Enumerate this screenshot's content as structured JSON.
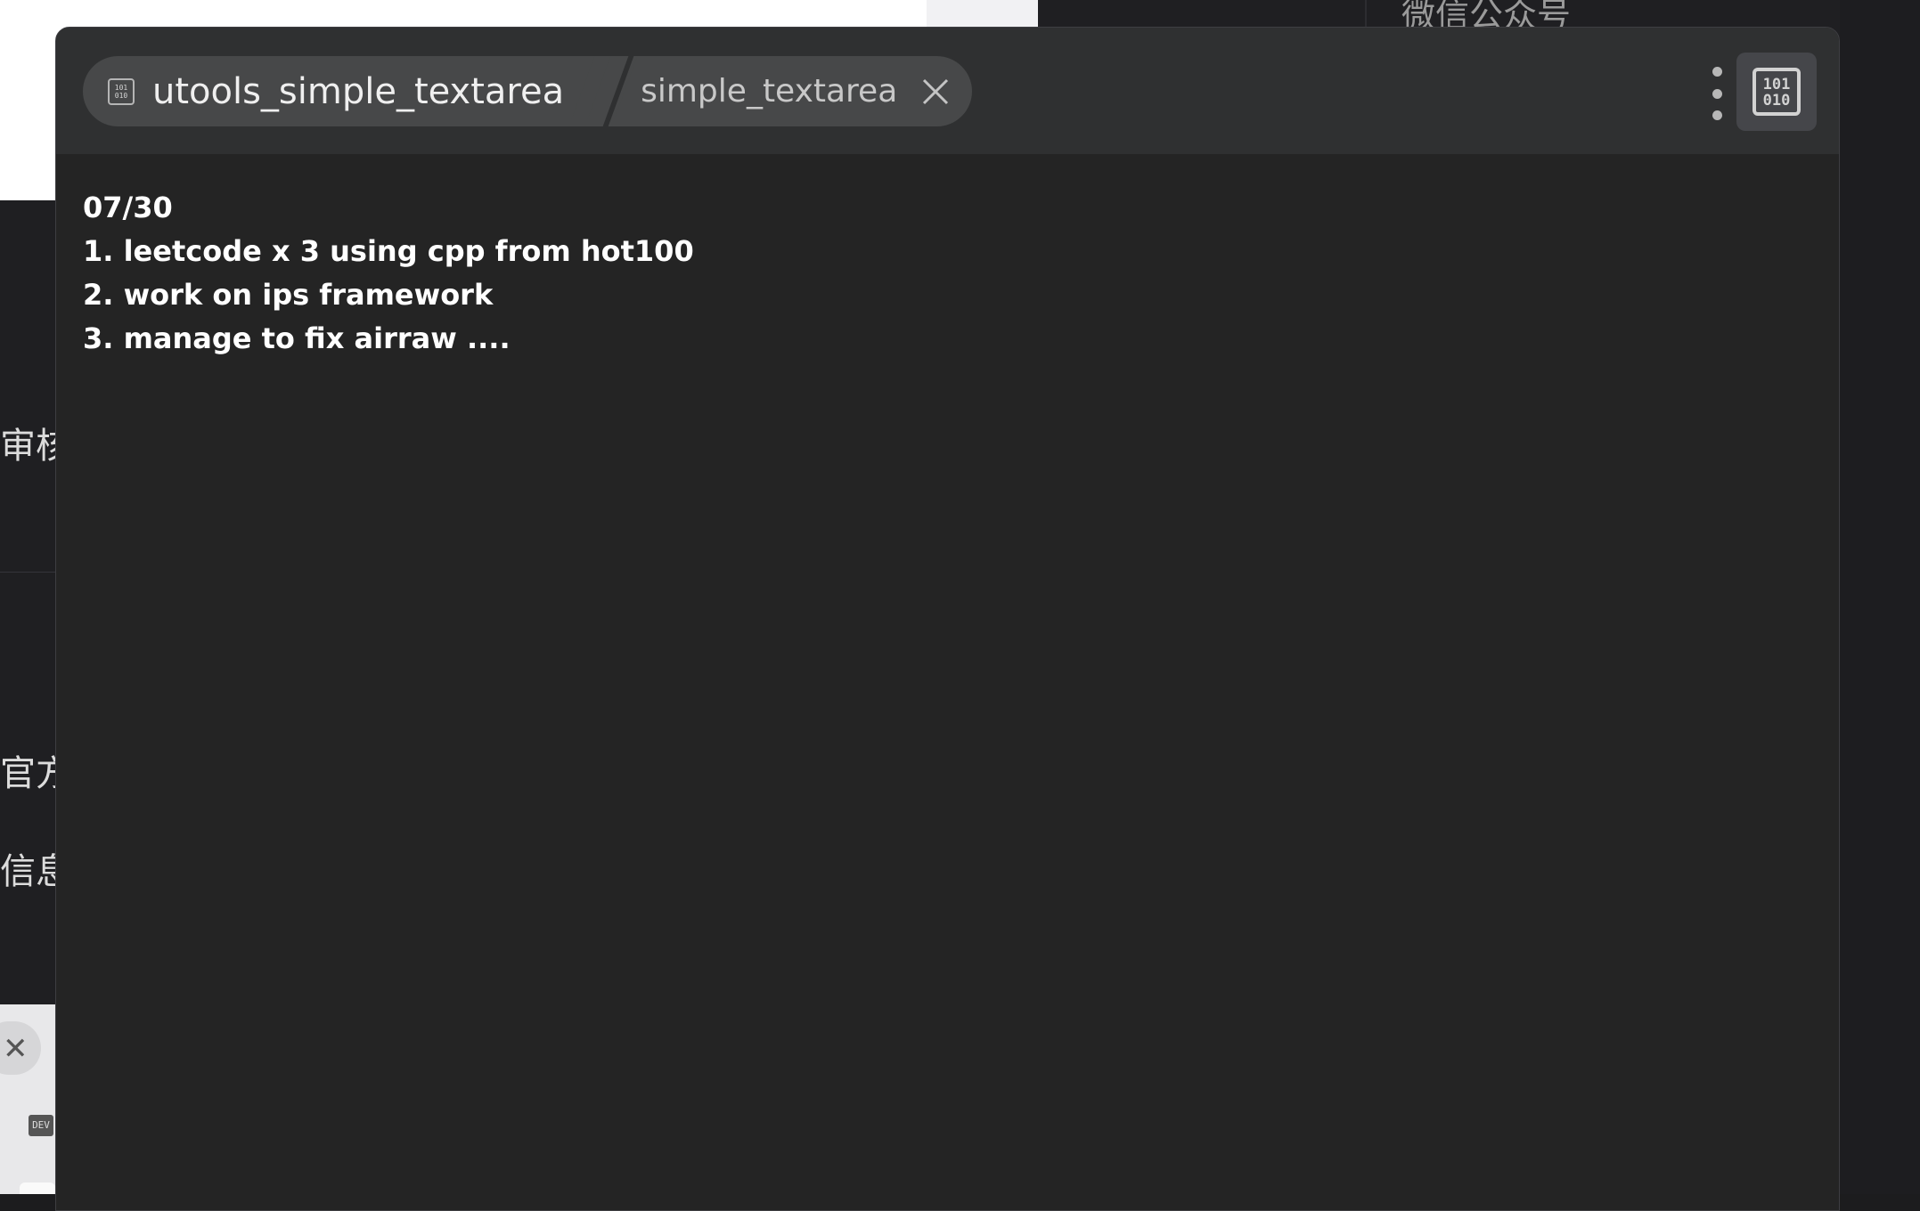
{
  "background": {
    "right_panel_text": "微信公众号",
    "left_fragments": [
      "审核通",
      "官方",
      "信息"
    ],
    "dev_badge": "DEV"
  },
  "window": {
    "tabs": [
      {
        "label": "utools_simple_textarea",
        "icon": "binary-app-icon"
      },
      {
        "label": "simple_textarea",
        "icon": "close-icon"
      }
    ],
    "menu_icon": "more-vertical-icon",
    "plugin_icon": "binary-plugin-icon"
  },
  "editor": {
    "lines": [
      "07/30",
      "1. leetcode x 3 using cpp from hot100",
      "2. work on ips framework",
      "3. manage to fix airraw ...."
    ]
  },
  "colors": {
    "window_bg": "#242424",
    "titlebar_bg": "#2f3031",
    "tab_bg": "#474849",
    "text": "#ffffff"
  }
}
